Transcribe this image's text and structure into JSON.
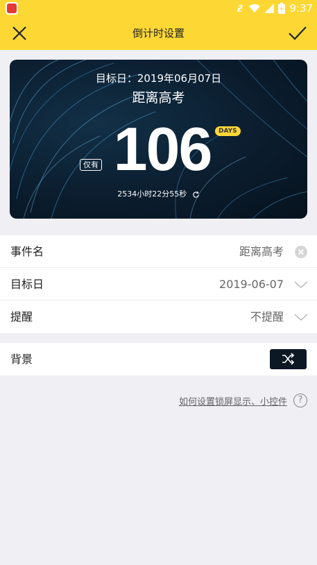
{
  "statusbar": {
    "time": "9:37"
  },
  "toolbar": {
    "title": "倒计时设置"
  },
  "card": {
    "target_date_text": "目标日：2019年06月07日",
    "event_name": "距离高考",
    "only_label": "仅有",
    "days": "106",
    "unit": "DAYS",
    "precise": "2534小时22分55秒"
  },
  "form": {
    "event": {
      "label": "事件名",
      "value": "距离高考"
    },
    "date": {
      "label": "目标日",
      "value": "2019-06-07"
    },
    "reminder": {
      "label": "提醒",
      "value": "不提醒"
    },
    "background": {
      "label": "背景"
    }
  },
  "help": {
    "link": "如何设置锁屏显示、小控件",
    "icon": "?"
  },
  "colors": {
    "accent": "#fdd835",
    "page_bg": "#efeff4"
  }
}
